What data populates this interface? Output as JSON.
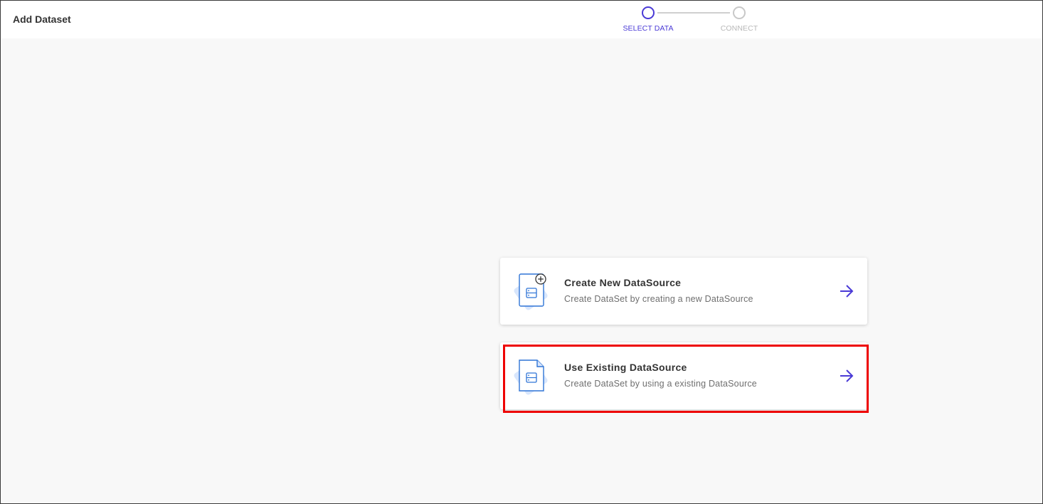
{
  "header": {
    "title": "Add Dataset"
  },
  "stepper": {
    "steps": [
      {
        "label": "SELECT DATA",
        "active": true
      },
      {
        "label": "CONNECT",
        "active": false
      }
    ],
    "active_color": "#4a3ad6",
    "inactive_color": "#b8b8b8"
  },
  "options": [
    {
      "title": "Create New DataSource",
      "description": "Create DataSet by creating a new DataSource",
      "icon": "document-plus-icon"
    },
    {
      "title": "Use Existing DataSource",
      "description": "Create DataSet by using a existing DataSource",
      "icon": "document-icon"
    }
  ],
  "colors": {
    "accent": "#4a3ad6",
    "icon_blue": "#2f74d6",
    "icon_bg": "#cfe0fb",
    "highlight": "#ee0000"
  }
}
